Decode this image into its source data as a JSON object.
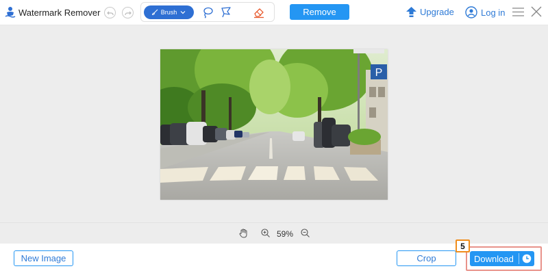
{
  "app": {
    "title": "Watermark Remover"
  },
  "toolbar": {
    "undo_icon": "undo-icon",
    "redo_icon": "redo-icon",
    "brush_label": "Brush",
    "tools": [
      "brush",
      "lasso",
      "polygonal-lasso",
      "eraser"
    ],
    "remove_label": "Remove"
  },
  "header": {
    "upgrade_label": "Upgrade",
    "login_label": "Log in"
  },
  "zoom": {
    "level": "59%"
  },
  "footer": {
    "new_image_label": "New Image",
    "crop_label": "Crop",
    "download_label": "Download"
  },
  "annotation": {
    "step_number": "5"
  },
  "colors": {
    "accent": "#2496f3",
    "brush_active": "#2e6fd3",
    "highlight_border": "#e8928a",
    "badge_border": "#f08c1a"
  }
}
